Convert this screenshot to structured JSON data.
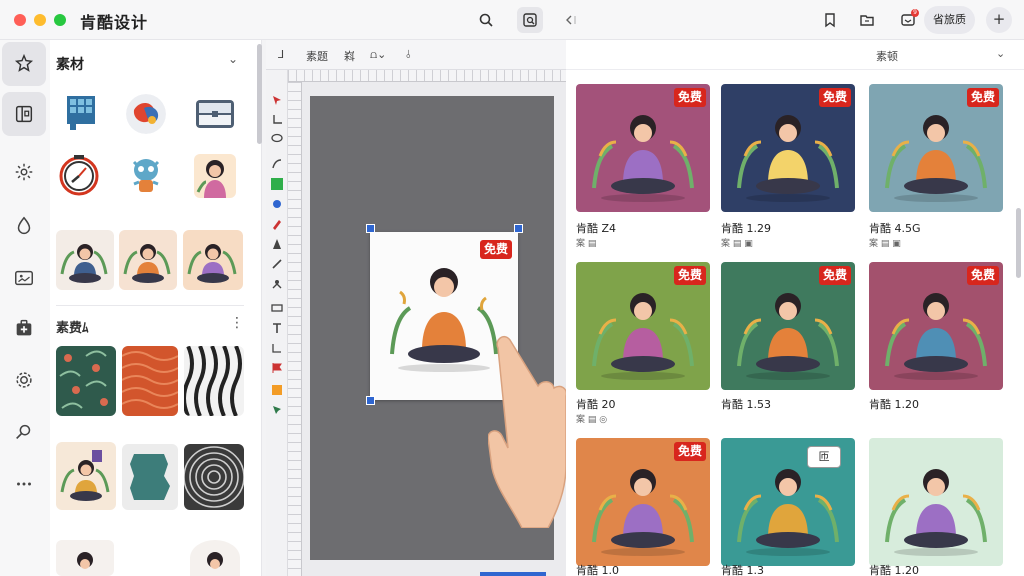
{
  "app": {
    "title": "肯酷设计"
  },
  "topbar": {
    "member_label": "省旅质",
    "plus_label": "+",
    "notif_count": "9"
  },
  "panel": {
    "title": "素材",
    "section2_title": "素费ﾑ",
    "more": "⋮",
    "chev": "⌄"
  },
  "canvas": {
    "toolbar_items": [
      "⅃",
      "素题",
      "嵙",
      "⩍⌄",
      "⫰"
    ],
    "free_label": "免费"
  },
  "right": {
    "header_label": "素顿",
    "header_chev": "⌄",
    "free_label": "免费",
    "speech_label": "匝",
    "cards": [
      {
        "name": "肯酷 Z4",
        "meta": "案 ▤",
        "bg": "#a3527a"
      },
      {
        "name": "肯酷 1.29",
        "meta": "案 ▤ ▣",
        "bg": "#2f3f66"
      },
      {
        "name": "肯酷 4.5G",
        "meta": "案 ▤ ▣",
        "bg": "#7fa5b2"
      },
      {
        "name": "肯酷 20",
        "meta": "案 ▤ ◎",
        "bg": "#7fa34a"
      },
      {
        "name": "肯酷 1.53",
        "meta": "",
        "bg": "#3f7a5e"
      },
      {
        "name": "肯酷 1.20",
        "meta": "",
        "bg": "#a3516d"
      },
      {
        "name": "肯酷 1.0",
        "meta": "",
        "bg": "#e0864a"
      },
      {
        "name": "肯酷 1.3",
        "meta": "",
        "bg": "#3a9a95"
      },
      {
        "name": "肯酷 1.20",
        "meta": "",
        "bg": "#d7ecdc"
      }
    ]
  }
}
